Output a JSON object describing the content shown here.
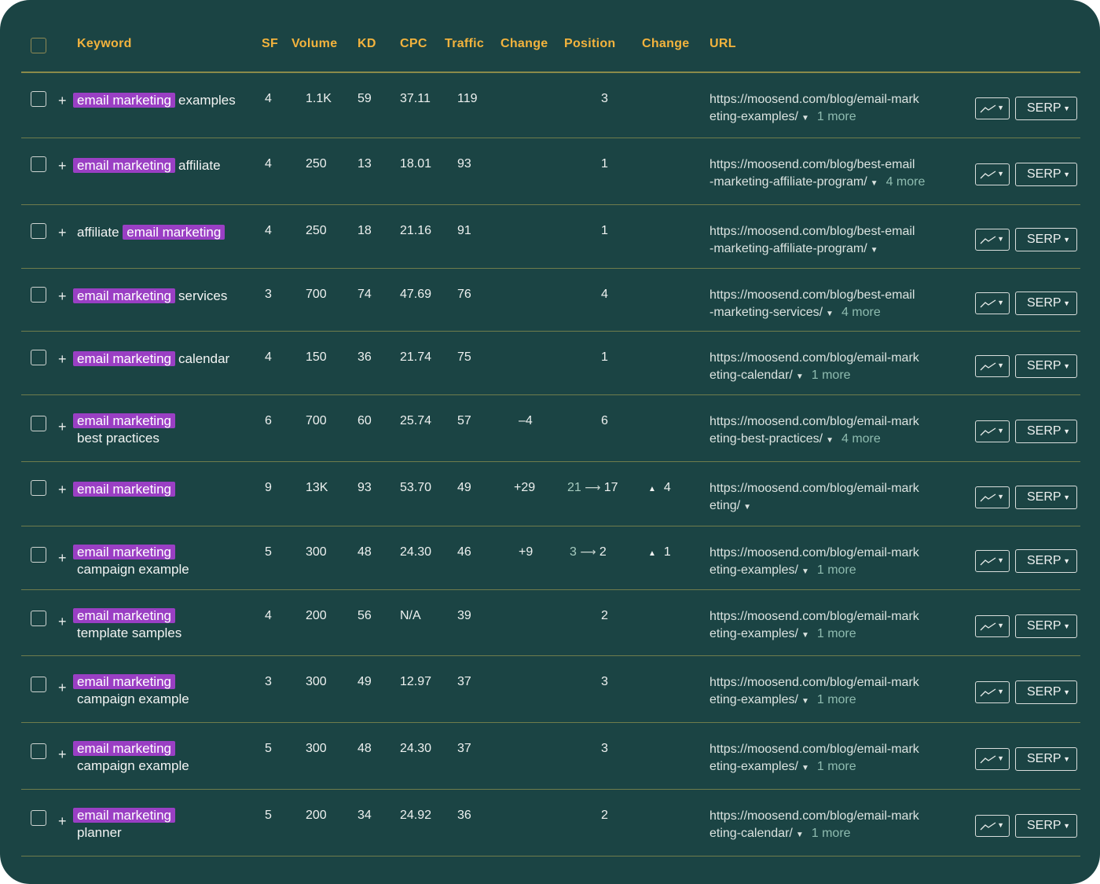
{
  "columns": {
    "keyword": "Keyword",
    "sf": "SF",
    "volume": "Volume",
    "kd": "KD",
    "cpc": "CPC",
    "traffic": "Traffic",
    "change": "Change",
    "position": "Position",
    "pos_change": "Change",
    "url": "URL"
  },
  "serp_label": "SERP",
  "colors": {
    "background": "#1b4444",
    "header_text": "#f3b33d",
    "keyword_highlight": "#9a3fc4",
    "more_link": "#8fbcb0"
  },
  "rows": [
    {
      "kw_pre": "",
      "kw_hl": "email marketing",
      "kw_post": "examples",
      "kw_line2": "",
      "sf": "4",
      "volume": "1.1K",
      "kd": "59",
      "cpc": "37.11",
      "traffic": "119",
      "change": "",
      "pos_old": "",
      "position": "3",
      "pos_change": "",
      "url1": "https://moosend.com/blog/email-mark",
      "url2": "eting-examples/",
      "more": "1 more"
    },
    {
      "kw_pre": "",
      "kw_hl": "email marketing",
      "kw_post": "affiliate",
      "kw_line2": "",
      "sf": "4",
      "volume": "250",
      "kd": "13",
      "cpc": "18.01",
      "traffic": "93",
      "change": "",
      "pos_old": "",
      "position": "1",
      "pos_change": "",
      "url1": "https://moosend.com/blog/best-email",
      "url2": "-marketing-affiliate-program/",
      "more": "4 more"
    },
    {
      "kw_pre": "affiliate",
      "kw_hl": "email marketing",
      "kw_post": "",
      "kw_line2": "",
      "sf": "4",
      "volume": "250",
      "kd": "18",
      "cpc": "21.16",
      "traffic": "91",
      "change": "",
      "pos_old": "",
      "position": "1",
      "pos_change": "",
      "url1": "https://moosend.com/blog/best-email",
      "url2": "-marketing-affiliate-program/",
      "more": ""
    },
    {
      "kw_pre": "",
      "kw_hl": "email marketing",
      "kw_post": "services",
      "kw_line2": "",
      "sf": "3",
      "volume": "700",
      "kd": "74",
      "cpc": "47.69",
      "traffic": "76",
      "change": "",
      "pos_old": "",
      "position": "4",
      "pos_change": "",
      "url1": "https://moosend.com/blog/best-email",
      "url2": "-marketing-services/",
      "more": "4 more"
    },
    {
      "kw_pre": "",
      "kw_hl": "email marketing",
      "kw_post": "calendar",
      "kw_line2": "",
      "sf": "4",
      "volume": "150",
      "kd": "36",
      "cpc": "21.74",
      "traffic": "75",
      "change": "",
      "pos_old": "",
      "position": "1",
      "pos_change": "",
      "url1": "https://moosend.com/blog/email-mark",
      "url2": "eting-calendar/",
      "more": "1 more"
    },
    {
      "kw_pre": "",
      "kw_hl": "email marketing",
      "kw_post": "",
      "kw_line2": "best practices",
      "sf": "6",
      "volume": "700",
      "kd": "60",
      "cpc": "25.74",
      "traffic": "57",
      "change": "–4",
      "pos_old": "",
      "position": "6",
      "pos_change": "",
      "url1": "https://moosend.com/blog/email-mark",
      "url2": "eting-best-practices/",
      "more": "4 more"
    },
    {
      "kw_pre": "",
      "kw_hl": "email marketing",
      "kw_post": "",
      "kw_line2": "",
      "sf": "9",
      "volume": "13K",
      "kd": "93",
      "cpc": "53.70",
      "traffic": "49",
      "change": "+29",
      "pos_old": "21",
      "position": "17",
      "pos_change": "4",
      "url1": "https://moosend.com/blog/email-mark",
      "url2": "eting/",
      "more": ""
    },
    {
      "kw_pre": "",
      "kw_hl": "email marketing",
      "kw_post": "",
      "kw_line2": "campaign example",
      "sf": "5",
      "volume": "300",
      "kd": "48",
      "cpc": "24.30",
      "traffic": "46",
      "change": "+9",
      "pos_old": "3",
      "position": "2",
      "pos_change": "1",
      "url1": "https://moosend.com/blog/email-mark",
      "url2": "eting-examples/",
      "more": "1 more"
    },
    {
      "kw_pre": "",
      "kw_hl": "email marketing",
      "kw_post": "",
      "kw_line2": "template samples",
      "sf": "4",
      "volume": "200",
      "kd": "56",
      "cpc": "N/A",
      "traffic": "39",
      "change": "",
      "pos_old": "",
      "position": "2",
      "pos_change": "",
      "url1": "https://moosend.com/blog/email-mark",
      "url2": "eting-examples/",
      "more": "1 more"
    },
    {
      "kw_pre": "",
      "kw_hl": "email marketing",
      "kw_post": "",
      "kw_line2": "campaign example",
      "sf": "3",
      "volume": "300",
      "kd": "49",
      "cpc": "12.97",
      "traffic": "37",
      "change": "",
      "pos_old": "",
      "position": "3",
      "pos_change": "",
      "url1": "https://moosend.com/blog/email-mark",
      "url2": "eting-examples/",
      "more": "1 more"
    },
    {
      "kw_pre": "",
      "kw_hl": "email marketing",
      "kw_post": "",
      "kw_line2": "campaign example",
      "sf": "5",
      "volume": "300",
      "kd": "48",
      "cpc": "24.30",
      "traffic": "37",
      "change": "",
      "pos_old": "",
      "position": "3",
      "pos_change": "",
      "url1": "https://moosend.com/blog/email-mark",
      "url2": "eting-examples/",
      "more": "1 more"
    },
    {
      "kw_pre": "",
      "kw_hl": "email marketing",
      "kw_post": "",
      "kw_line2": "planner",
      "sf": "5",
      "volume": "200",
      "kd": "34",
      "cpc": "24.92",
      "traffic": "36",
      "change": "",
      "pos_old": "",
      "position": "2",
      "pos_change": "",
      "url1": "https://moosend.com/blog/email-mark",
      "url2": "eting-calendar/",
      "more": "1 more"
    }
  ]
}
